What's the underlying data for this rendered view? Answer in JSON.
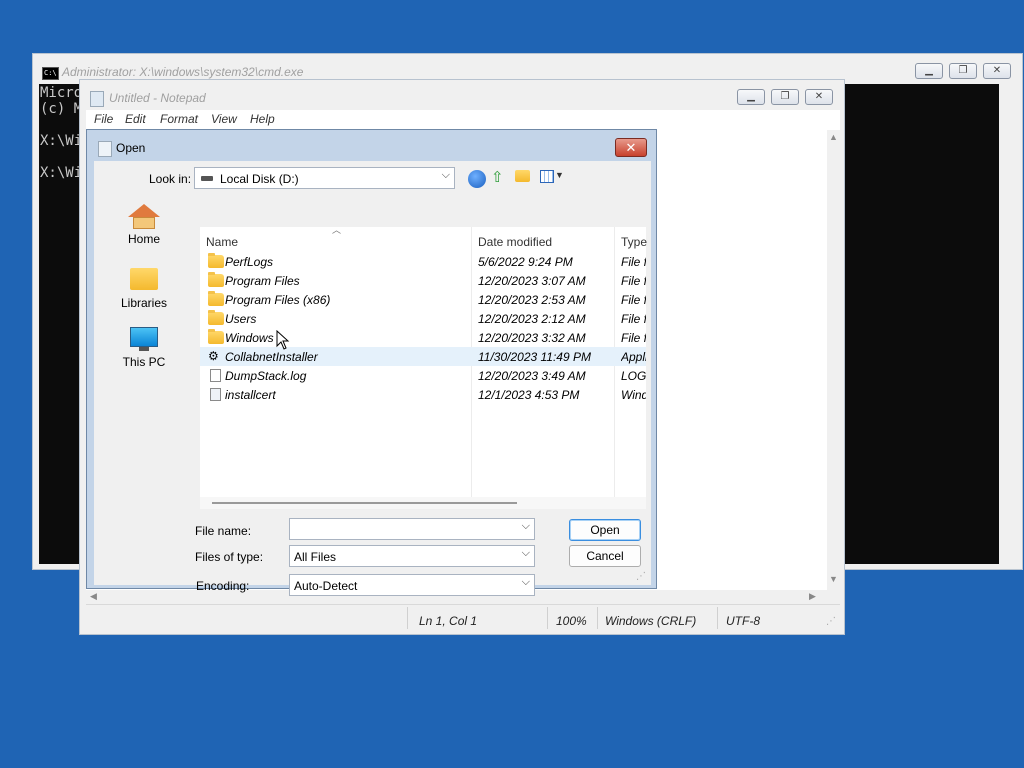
{
  "cmd": {
    "title": "Administrator: X:\\windows\\system32\\cmd.exe",
    "icon": "console-icon",
    "icon_label": "C:\\",
    "lines": [
      "Micro",
      "(c) M",
      "X:\\Wi",
      "X:\\Wi"
    ]
  },
  "notepad": {
    "title": "Untitled - Notepad",
    "menus": [
      "File",
      "Edit",
      "Format",
      "View",
      "Help"
    ],
    "status": {
      "position": "Ln 1, Col 1",
      "zoom": "100%",
      "line_ending": "Windows (CRLF)",
      "encoding": "UTF-8"
    }
  },
  "dialog": {
    "title": "Open",
    "close_label": "✕",
    "look_in_label": "Look in:",
    "look_in_value": "Local Disk (D:)",
    "places": [
      {
        "label": "Home",
        "icon": "home-icon"
      },
      {
        "label": "Libraries",
        "icon": "libraries-icon"
      },
      {
        "label": "This PC",
        "icon": "this-pc-icon"
      }
    ],
    "columns": {
      "name": "Name",
      "date": "Date modified",
      "type": "Type"
    },
    "files": [
      {
        "name": "PerfLogs",
        "date": "5/6/2022 9:24 PM",
        "type": "File fo",
        "icon": "folder-icon"
      },
      {
        "name": "Program Files",
        "date": "12/20/2023 3:07 AM",
        "type": "File fo",
        "icon": "folder-icon"
      },
      {
        "name": "Program Files (x86)",
        "date": "12/20/2023 2:53 AM",
        "type": "File fo",
        "icon": "folder-icon"
      },
      {
        "name": "Users",
        "date": "12/20/2023 2:12 AM",
        "type": "File fo",
        "icon": "folder-icon"
      },
      {
        "name": "Windows",
        "date": "12/20/2023 3:32 AM",
        "type": "File fo",
        "icon": "folder-icon"
      },
      {
        "name": "CollabnetInstaller",
        "date": "11/30/2023 11:49 PM",
        "type": "Appli",
        "icon": "application-icon"
      },
      {
        "name": "DumpStack.log",
        "date": "12/20/2023 3:49 AM",
        "type": "LOG f",
        "icon": "document-icon"
      },
      {
        "name": "installcert",
        "date": "12/1/2023 4:53 PM",
        "type": "Wind",
        "icon": "script-icon"
      }
    ],
    "file_name_label": "File name:",
    "file_name_value": "",
    "files_of_type_label": "Files of type:",
    "files_of_type_value": "All Files",
    "encoding_label": "Encoding:",
    "encoding_value": "Auto-Detect",
    "open_label": "Open",
    "cancel_label": "Cancel"
  }
}
